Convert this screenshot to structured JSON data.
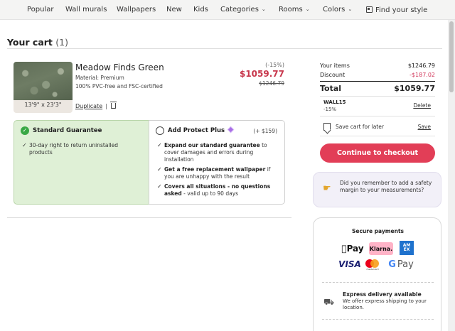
{
  "nav": {
    "items": [
      "Popular",
      "Wall murals",
      "Wallpapers",
      "New",
      "Kids",
      "Categories",
      "Rooms",
      "Colors",
      "Find your style"
    ]
  },
  "cart": {
    "title": "Your cart",
    "count": "(1)"
  },
  "product": {
    "name": "Meadow Finds Green",
    "material": "Material: Premium",
    "certification": "100% PVC-free and FSC-certified",
    "size": "13'9\" x 23'3\"",
    "duplicate_label": "Duplicate",
    "separator": "|",
    "discount_pct": "(-15%)",
    "price": "$1059.77",
    "original_price": "$1246.79"
  },
  "guarantee": {
    "standard": {
      "title": "Standard Guarantee",
      "bullets": [
        "30-day right to return uninstalled products"
      ]
    },
    "plus": {
      "title": "Add Protect Plus",
      "price": "(+ $159)",
      "bullet1_bold": "Expand our standard guarantee",
      "bullet1_rest": " to cover damages and errors during installation",
      "bullet2_bold": "Get a free replacement wallpaper",
      "bullet2_rest": " if you are unhappy with the result",
      "bullet3_bold": "Covers all situations - no questions asked",
      "bullet3_rest": " - valid up to 90 days"
    }
  },
  "summary": {
    "items_label": "Your items",
    "items_value": "$1246.79",
    "discount_label": "Discount",
    "discount_value": "-$187.02",
    "total_label": "Total",
    "total_value": "$1059.77",
    "code": "WALL15",
    "code_pct": "-15%",
    "delete_label": "Delete",
    "save_cart_label": "Save cart for later",
    "save_label": "Save",
    "checkout_label": "Continue to checkout",
    "accent_color": "#e23e57"
  },
  "tip": {
    "text": "Did you remember to add a safety margin to your measurements?"
  },
  "payments": {
    "title": "Secure payments",
    "apple_pay": "Pay",
    "klarna": "Klarna.",
    "amex": "AM EX",
    "visa": "VISA",
    "mastercard_caption": "mastercard",
    "google_pay": "Pay",
    "delivery_title": "Express delivery available",
    "delivery_text": "We offer express shipping to your location."
  }
}
